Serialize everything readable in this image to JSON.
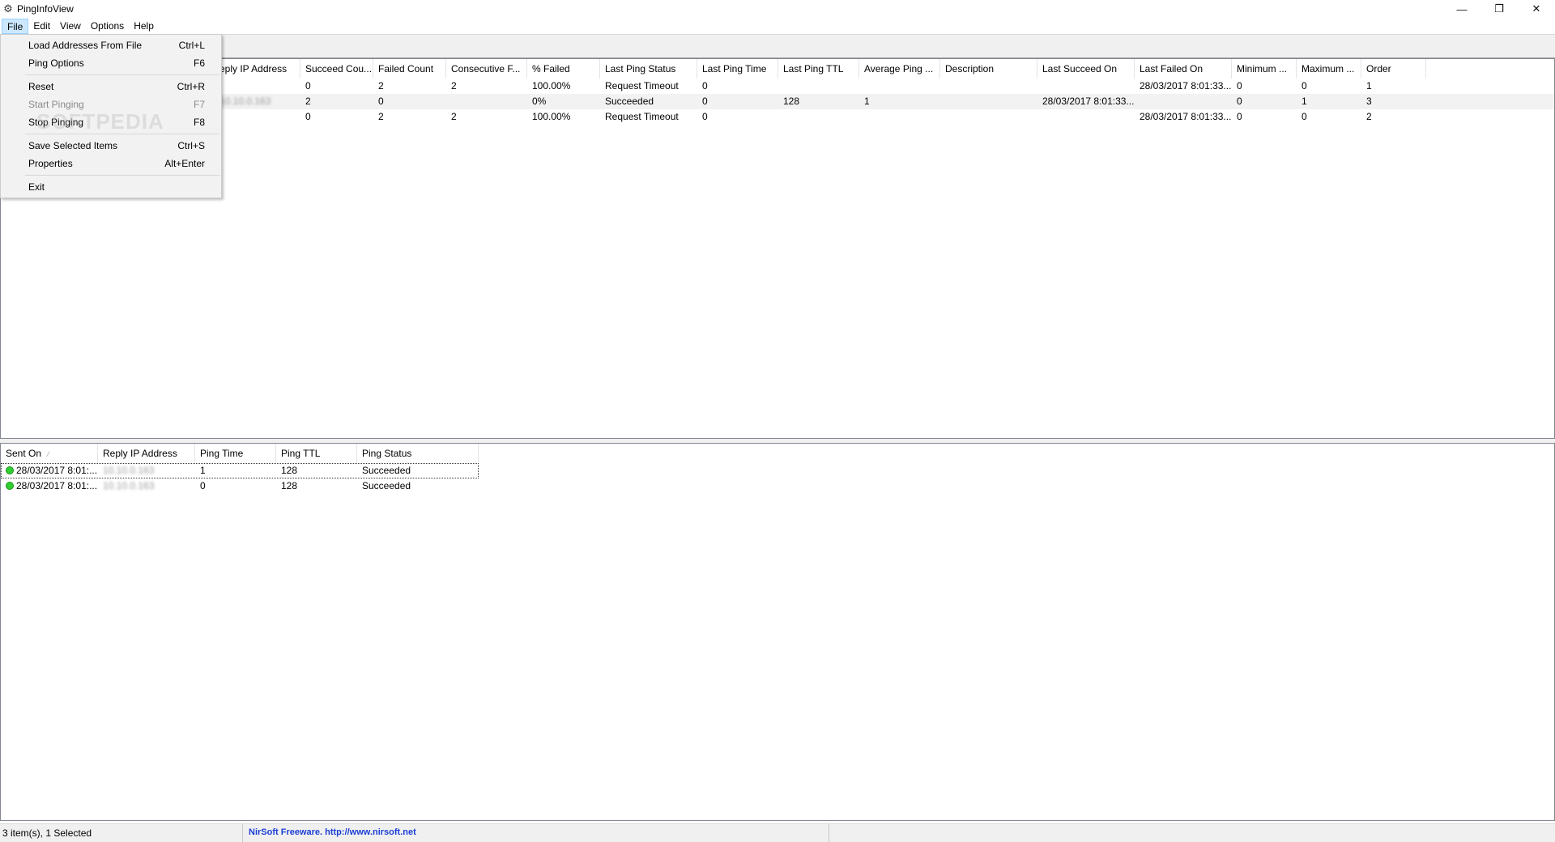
{
  "window": {
    "title": "PingInfoView",
    "controls": {
      "minimize": "—",
      "restore": "❐",
      "close": "✕"
    }
  },
  "menubar": {
    "items": [
      {
        "label": "File",
        "active": true
      },
      {
        "label": "Edit"
      },
      {
        "label": "View"
      },
      {
        "label": "Options"
      },
      {
        "label": "Help"
      }
    ]
  },
  "file_menu": {
    "items": [
      {
        "label": "Load Addresses From File",
        "shortcut": "Ctrl+L"
      },
      {
        "label": "Ping Options",
        "shortcut": "F6"
      },
      {
        "label": "Reset",
        "shortcut": "Ctrl+R"
      },
      {
        "label": "Start Pinging",
        "shortcut": "F7",
        "disabled": true
      },
      {
        "label": "Stop Pinging",
        "shortcut": "F8"
      },
      {
        "label": "Save Selected Items",
        "shortcut": "Ctrl+S"
      },
      {
        "label": "Properties",
        "shortcut": "Alt+Enter"
      },
      {
        "label": "Exit",
        "shortcut": ""
      }
    ],
    "watermark": "SOFTPEDIA"
  },
  "top_table": {
    "columns": [
      "",
      "eply IP Address",
      "Succeed Cou...",
      "Failed Count",
      "Consecutive F...",
      "% Failed",
      "Last Ping Status",
      "Last Ping Time",
      "Last Ping TTL",
      "Average Ping ...",
      "Description",
      "Last Succeed On",
      "Last Failed On",
      "Minimum ...",
      "Maximum ...",
      "Order"
    ],
    "rows": [
      [
        "",
        "",
        "0",
        "2",
        "2",
        "100.00%",
        "Request Timeout",
        "0",
        "",
        "",
        "",
        "",
        "28/03/2017 8:01:33...",
        "0",
        "0",
        "1"
      ],
      [
        "",
        "10.10.0.163",
        "2",
        "0",
        "",
        "0%",
        "Succeeded",
        "0",
        "128",
        "1",
        "",
        "28/03/2017 8:01:33...",
        "",
        "0",
        "1",
        "3"
      ],
      [
        "",
        "",
        "0",
        "2",
        "2",
        "100.00%",
        "Request Timeout",
        "0",
        "",
        "",
        "",
        "",
        "28/03/2017 8:01:33...",
        "0",
        "0",
        "2"
      ]
    ]
  },
  "bottom_table": {
    "columns": [
      "Sent On",
      "Reply IP Address",
      "Ping Time",
      "Ping TTL",
      "Ping Status"
    ],
    "rows": [
      [
        "28/03/2017 8:01:...",
        "10.10.0.163",
        "1",
        "128",
        "Succeeded"
      ],
      [
        "28/03/2017 8:01:...",
        "10.10.0.163",
        "0",
        "128",
        "Succeeded"
      ]
    ],
    "sort_indicator": "⁄"
  },
  "statusbar": {
    "items_text": "3 item(s), 1 Selected",
    "freeware_text": "NirSoft Freeware.  http://www.nirsoft.net"
  }
}
